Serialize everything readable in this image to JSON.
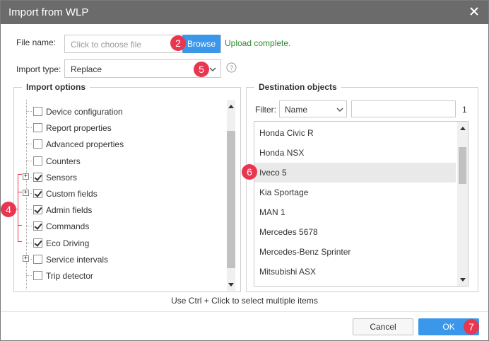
{
  "dialog": {
    "title": "Import from WLP",
    "close_icon": "close-icon"
  },
  "file": {
    "label": "File name:",
    "placeholder": "Click to choose file",
    "browse_label": "Browse",
    "status": "Upload complete.",
    "status_color": "#2e8b2e"
  },
  "import_type": {
    "label": "Import type:",
    "value": "Replace",
    "help_icon": "help-icon"
  },
  "import_options": {
    "title": "Import options",
    "items": [
      {
        "label": "Device configuration",
        "checked": false,
        "expandable": false
      },
      {
        "label": "Report properties",
        "checked": false,
        "expandable": false
      },
      {
        "label": "Advanced properties",
        "checked": false,
        "expandable": false
      },
      {
        "label": "Counters",
        "checked": false,
        "expandable": false
      },
      {
        "label": "Sensors",
        "checked": true,
        "expandable": true
      },
      {
        "label": "Custom fields",
        "checked": true,
        "expandable": true
      },
      {
        "label": "Admin fields",
        "checked": true,
        "expandable": false
      },
      {
        "label": "Commands",
        "checked": true,
        "expandable": false
      },
      {
        "label": "Eco Driving",
        "checked": true,
        "expandable": false
      },
      {
        "label": "Service intervals",
        "checked": false,
        "expandable": true
      },
      {
        "label": "Trip detector",
        "checked": false,
        "expandable": false
      }
    ]
  },
  "destination": {
    "title": "Destination objects",
    "filter_label": "Filter:",
    "filter_select": "Name",
    "filter_value": "",
    "count": "1",
    "objects": [
      {
        "name": "Honda Civic R",
        "highlighted": false
      },
      {
        "name": "Honda NSX",
        "highlighted": false
      },
      {
        "name": "Iveco 5",
        "highlighted": true
      },
      {
        "name": "Kia Sportage",
        "highlighted": false
      },
      {
        "name": "MAN 1",
        "highlighted": false
      },
      {
        "name": "Mercedes 5678",
        "highlighted": false
      },
      {
        "name": "Mercedes-Benz Sprinter",
        "highlighted": false
      },
      {
        "name": "Mitsubishi ASX",
        "highlighted": false
      }
    ]
  },
  "hint": "Use Ctrl + Click to select multiple items",
  "footer": {
    "cancel_label": "Cancel",
    "ok_label": "OK"
  },
  "badges": {
    "b2": "2",
    "b4": "4",
    "b5": "5",
    "b6": "6",
    "b7": "7"
  },
  "colors": {
    "accent": "#3a97e9",
    "badge": "#e8364f",
    "titlebar": "#6b6b6b"
  }
}
